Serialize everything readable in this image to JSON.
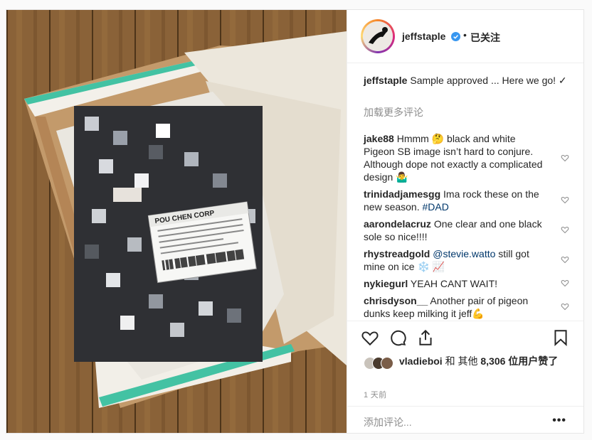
{
  "post": {
    "username": "jeffstaple",
    "follow_status": "已关注",
    "bullet": "•",
    "caption": "Sample approved ... Here we go! ✓",
    "load_more": "加载更多评论",
    "comments": [
      {
        "user": "jake88",
        "text": "Hmmm 🤔 black and white Pigeon SB image isn’t hard to conjure. Although dope not exactly a complicated design 🤷‍♂️"
      },
      {
        "user": "trinidadjamesgg",
        "text": "Ima rock these on the new season.",
        "hashtag": "#DAD"
      },
      {
        "user": "aarondelacruz",
        "text": "One clear and one black sole so nice!!!!"
      },
      {
        "user": "rhystreadgold",
        "mention": "@stevie.watto",
        "text": "still got mine on ice ❄️ 📈"
      },
      {
        "user": "nykiegurl",
        "text": "YEAH CANT WAIT!"
      },
      {
        "user": "chrisdyson__",
        "text": "Another pair of pigeon dunks keep milking it jeff💪"
      }
    ],
    "likes_user": "vladieboi",
    "likes_rest": "和 其他",
    "likes_count": "8,306",
    "likes_suffix": "位用户赞了",
    "time_ago": "1 天前",
    "add_comment_placeholder": "添加评论...",
    "more_label": "•••"
  },
  "label": {
    "brand": "POU CHEN CORP"
  },
  "colors": {
    "verified": "#3897f0",
    "box_teal": "#43c2a3",
    "floor": "#7d5a33"
  },
  "icons": [
    "heart-icon",
    "comment-icon",
    "share-icon",
    "bookmark-icon",
    "verified-icon",
    "small-heart-icon"
  ]
}
